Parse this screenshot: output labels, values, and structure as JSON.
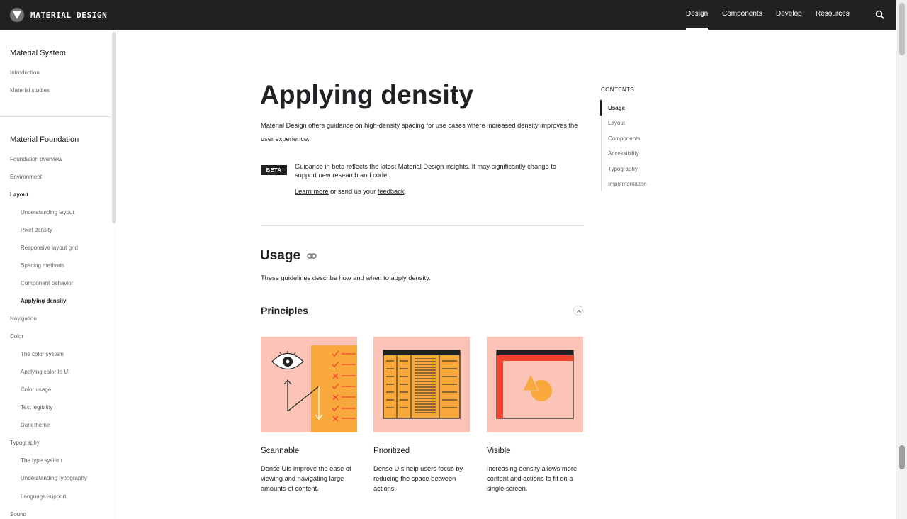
{
  "header": {
    "brand": "MATERIAL DESIGN",
    "nav": [
      "Design",
      "Components",
      "Develop",
      "Resources"
    ],
    "active_nav": "Design",
    "search_icon": "search-icon"
  },
  "sidebar": {
    "sections": [
      {
        "title": "Material System",
        "items": [
          "Introduction",
          "Material studies"
        ]
      },
      {
        "title": "Material Foundation"
      }
    ],
    "items": [
      "Foundation overview",
      "Environment",
      "Layout",
      "Understanding layout",
      "Pixel density",
      "Responsive layout grid",
      "Spacing methods",
      "Component behavior",
      "Applying density",
      "Navigation",
      "Color",
      "The color system",
      "Applying color to UI",
      "Color usage",
      "Text legibility",
      "Dark theme",
      "Typography",
      "The type system",
      "Understanding typography",
      "Language support",
      "Sound"
    ]
  },
  "main": {
    "title": "Applying density",
    "intro": "Material Design offers guidance on high-density spacing for use cases where increased density improves the user experience.",
    "beta": {
      "badge": "BETA",
      "text": "Guidance in beta reflects the latest Material Design insights. It may significantly change to support new research and code.",
      "learn_more": "Learn more",
      "middle": " or send us your ",
      "feedback": "feedback",
      "end": "."
    },
    "usage_title": "Usage",
    "usage_desc": "These guidelines describe how and when to apply density.",
    "principles_title": "Principles",
    "cards": [
      {
        "title": "Scannable",
        "desc": "Dense UIs improve the ease of viewing and navigating large amounts of content."
      },
      {
        "title": "Prioritized",
        "desc": "Dense UIs help users focus by reducing the space between actions."
      },
      {
        "title": "Visible",
        "desc": "Increasing density allows more content and actions to fit on a single screen."
      }
    ]
  },
  "contents": {
    "heading": "CONTENTS",
    "items": [
      "Usage",
      "Layout",
      "Components",
      "Accessibility",
      "Typography",
      "Implementation"
    ],
    "active": "Usage"
  },
  "colors": {
    "illustration_bg": "#fbc4b6",
    "orange": "#f9a93b",
    "red": "#f4432c",
    "dark": "#212121"
  }
}
